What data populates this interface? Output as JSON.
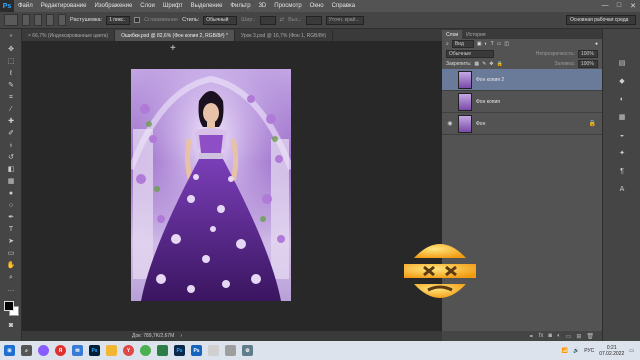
{
  "app": {
    "logo": "Ps"
  },
  "menu": [
    "Файл",
    "Редактирование",
    "Изображение",
    "Слои",
    "Шрифт",
    "Выделение",
    "Фильтр",
    "3D",
    "Просмотр",
    "Окно",
    "Справка"
  ],
  "window_controls": [
    "—",
    "□",
    "✕"
  ],
  "options": {
    "feather_label": "Растушевка:",
    "feather_value": "1 пикс.",
    "antialias_label": "Сглаживание",
    "style_label": "Стиль:",
    "style_value": "Обычный",
    "width_label": "Шир.:",
    "height_label": "Выс.:",
    "refine_button": "Уточн. край...",
    "workspace": "Основная рабочая среда"
  },
  "tabs": [
    {
      "label": "× 66,7% (Индексированные цвета)",
      "active": false
    },
    {
      "label": "Ошибки.psd @ 82,6% (Фон копия 2, RGB/8#) *",
      "active": true
    },
    {
      "label": "Урок 3.psd @ 16,7% (Фон 1, RGB/8#)",
      "active": false
    }
  ],
  "status": {
    "doc": "Док: 789,7K/2,67M"
  },
  "panel": {
    "tabs": [
      "Слои",
      "История"
    ],
    "kind_label": "Вид",
    "blend_mode": "Обычные",
    "opacity_label": "Непрозрачность:",
    "opacity_value": "100%",
    "lock_label": "Закрепить:",
    "fill_label": "Заливка:",
    "fill_value": "100%",
    "layers": [
      {
        "name": "Фон копия 2",
        "selected": true,
        "visible": false,
        "locked": false
      },
      {
        "name": "Фон копия",
        "selected": false,
        "visible": false,
        "locked": false
      },
      {
        "name": "Фон",
        "selected": false,
        "visible": true,
        "locked": true
      }
    ]
  },
  "taskbar": {
    "lang": "РУС",
    "time": "0:21",
    "date": "07.02.2022",
    "icons": [
      {
        "name": "start-icon",
        "color": "#1e6fd0"
      },
      {
        "name": "search-icon",
        "color": "#555555"
      },
      {
        "name": "alice-icon",
        "color": "#8a5cff"
      },
      {
        "name": "yandex-icon",
        "color": "#e03030"
      },
      {
        "name": "mail-icon",
        "color": "#3a7bd5"
      },
      {
        "name": "photoshop-icon",
        "color": "#001e36"
      },
      {
        "name": "explorer-icon",
        "color": "#f2b632"
      },
      {
        "name": "yandex-browser-icon",
        "color": "#e04848"
      },
      {
        "name": "chrome-icon",
        "color": "#4caf50"
      },
      {
        "name": "app-icon",
        "color": "#2d7d46"
      },
      {
        "name": "photoshop2-icon",
        "color": "#0b2a4a"
      },
      {
        "name": "ps-elements-icon",
        "color": "#1565c0"
      },
      {
        "name": "app2-icon",
        "color": "#d0d0d0"
      },
      {
        "name": "app3-icon",
        "color": "#9e9e9e"
      },
      {
        "name": "settings-icon",
        "color": "#607d8b"
      }
    ]
  }
}
